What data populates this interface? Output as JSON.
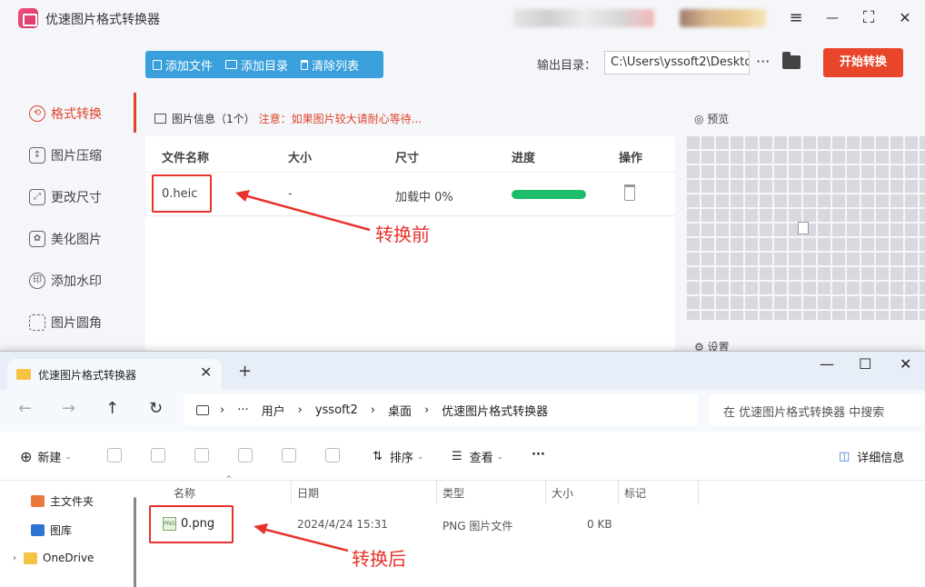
{
  "app": {
    "title": "优速图片格式转换器",
    "window_controls": {
      "menu": "≡",
      "minimize": "—",
      "maximize": "⛶",
      "close": "✕"
    }
  },
  "sidebar": {
    "items": [
      {
        "label": "格式转换",
        "icon": "format-convert-icon"
      },
      {
        "label": "图片压缩",
        "icon": "compress-icon"
      },
      {
        "label": "更改尺寸",
        "icon": "resize-icon"
      },
      {
        "label": "美化图片",
        "icon": "beautify-icon"
      },
      {
        "label": "添加水印",
        "icon": "watermark-icon"
      },
      {
        "label": "图片圆角",
        "icon": "round-corner-icon"
      }
    ],
    "active_index": 0
  },
  "toolbar": {
    "add_file": "添加文件",
    "add_dir": "添加目录",
    "clear_list": "清除列表"
  },
  "output": {
    "label": "输出目录：",
    "path": "C:\\Users\\yssoft2\\Deskto",
    "more": "···"
  },
  "start_button": "开始转换",
  "info_panel": {
    "title": "图片信息",
    "count": "（1个）",
    "warning": "注意：如果图片较大请耐心等待..."
  },
  "table": {
    "columns": [
      "文件名称",
      "大小",
      "尺寸",
      "进度",
      "操作"
    ],
    "rows": [
      {
        "name": "0.heic",
        "size": "-",
        "dimension": "加载中 0%",
        "progress": 1.0
      }
    ]
  },
  "annotations": {
    "before": "转换前",
    "after": "转换后"
  },
  "preview": {
    "title": "预览",
    "settings": "设置"
  },
  "explorer": {
    "tab_title": "优速图片格式转换器",
    "tab_close": "✕",
    "new_tab": "+",
    "window_controls": {
      "minimize": "—",
      "maximize": "☐",
      "close": "✕"
    },
    "nav": {
      "back": "←",
      "forward": "→",
      "up": "↑",
      "refresh": "↻"
    },
    "breadcrumb": [
      "···",
      "用户",
      "yssoft2",
      "桌面",
      "优速图片格式转换器"
    ],
    "breadcrumb_sep": "›",
    "search_placeholder": "在 优速图片格式转换器 中搜索",
    "commands": {
      "new": "新建",
      "sort": "排序",
      "view": "查看",
      "more": "···",
      "details": "详细信息"
    },
    "nav_pane": [
      {
        "label": "主文件夹",
        "icon": "home-icon"
      },
      {
        "label": "图库",
        "icon": "gallery-icon"
      },
      {
        "label": "OneDrive",
        "icon": "folder-icon"
      }
    ],
    "columns": [
      "名称",
      "日期",
      "类型",
      "大小",
      "标记"
    ],
    "files": [
      {
        "name": "0.png",
        "date": "2024/4/24 15:31",
        "type": "PNG 图片文件",
        "size": "0 KB"
      }
    ]
  }
}
